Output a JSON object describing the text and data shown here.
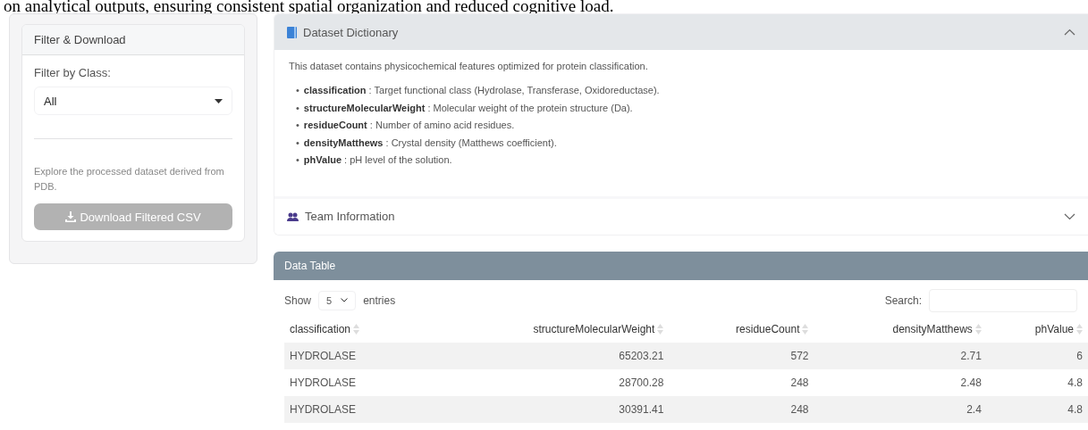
{
  "caption": "on analytical outputs, ensuring consistent spatial organization and reduced cognitive load.",
  "sidebar": {
    "title": "Filter & Download",
    "filter_label": "Filter by Class:",
    "filter_value": "All",
    "note": "Explore the processed dataset derived from PDB.",
    "download_button": {
      "label": "Download Filtered CSV",
      "disabled": true
    }
  },
  "accordion": [
    {
      "title": "Dataset Dictionary",
      "expanded": true,
      "intro": "This dataset contains physicochemical features optimized for protein classification.",
      "items": [
        {
          "bullet": "•",
          "term": "classification",
          "text": " : Target functional class (Hydrolase, Transferase, Oxidoreductase)."
        },
        {
          "bullet": "•",
          "term": "structureMolecularWeight",
          "text": " : Molecular weight of the protein structure (Da)."
        },
        {
          "bullet": "•",
          "term": "residueCount",
          "text": " : Number of amino acid residues."
        },
        {
          "bullet": "•",
          "term": "densityMatthews",
          "text": " : Crystal density (Matthews coefficient)."
        },
        {
          "bullet": "•",
          "term": "phValue",
          "text": " : pH level of the solution."
        }
      ]
    },
    {
      "title": "Team Information",
      "expanded": false
    }
  ],
  "data_table": {
    "title": "Data Table",
    "show_label": "Show",
    "page_size": "5",
    "entries_label": "entries",
    "search_label": "Search:",
    "columns": [
      "classification",
      "structureMolecularWeight",
      "residueCount",
      "densityMatthews",
      "phValue"
    ],
    "rows": [
      [
        "HYDROLASE",
        "65203.21",
        "572",
        "2.71",
        "6"
      ],
      [
        "HYDROLASE",
        "28700.28",
        "248",
        "2.48",
        "4.8"
      ],
      [
        "HYDROLASE",
        "30391.41",
        "248",
        "2.4",
        "4.8"
      ]
    ]
  }
}
